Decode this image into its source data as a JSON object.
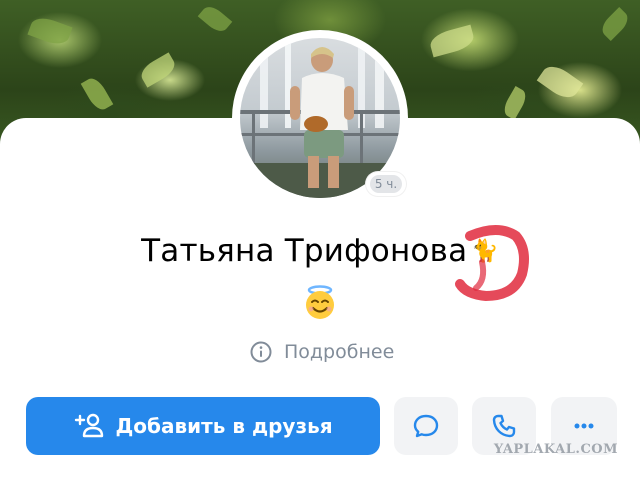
{
  "profile": {
    "name": "Татьяна Трифонова",
    "name_emoji": "🐈",
    "status_emoji": "😇",
    "online_time": "5 ч.",
    "details_label": "Подробнее"
  },
  "actions": {
    "add_friend_label": "Добавить в друзья"
  },
  "watermark": "YAPLAKAL.COM",
  "colors": {
    "primary_button": "#2688eb",
    "secondary_text": "#818c99",
    "icon_button_bg": "#f2f3f5",
    "annotation_mark": "#e02a3d"
  },
  "icons": {
    "details": "info-icon",
    "add_friend": "add-user-icon",
    "message": "message-icon",
    "call": "phone-icon",
    "more": "more-dots-icon"
  }
}
